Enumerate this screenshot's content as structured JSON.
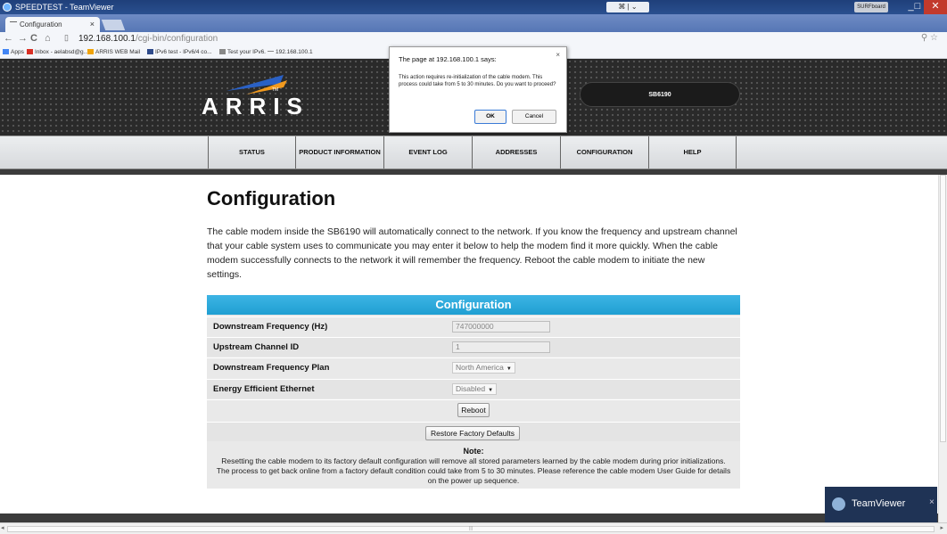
{
  "window": {
    "title": "SPEEDTEST - TeamViewer",
    "thumb_label": "⌘ | ⌄",
    "surfboard_label": "SURFboard"
  },
  "browser": {
    "tab_title": "Configuration",
    "url_host": "192.168.100.1",
    "url_path": "/cgi-bin/configuration",
    "bookmarks": [
      {
        "label": "Apps",
        "icon": "apps-grid-icon",
        "color": "#4285f4"
      },
      {
        "label": "Inbox - aelabsd@g...",
        "icon": "gmail-icon",
        "color": "#d93025"
      },
      {
        "label": "ARRIS WEB Mail",
        "icon": "mail-icon",
        "color": "#f0a30a"
      },
      {
        "label": "IPv6 test - IPv6/4 co...",
        "icon": "ipv6-icon",
        "color": "#2e4a8a"
      },
      {
        "label": "Test your IPv6.",
        "icon": "ipv6-test-icon",
        "color": "#888888"
      },
      {
        "label": "192.168.100.1",
        "icon": "link-icon",
        "color": "#888888"
      }
    ]
  },
  "header": {
    "brand": "ARRIS",
    "tm": "TM",
    "model": "SB6190"
  },
  "menu": [
    "STATUS",
    "PRODUCT INFORMATION",
    "EVENT LOG",
    "ADDRESSES",
    "CONFIGURATION",
    "HELP"
  ],
  "page": {
    "title": "Configuration",
    "intro": "The cable modem inside the SB6190 will automatically connect to the network. If you know the frequency and upstream channel that your cable system uses to communicate you may enter it below to help the modem find it more quickly. When the cable modem successfully connects to the network it will remember the frequency. Reboot the cable modem to initiate the new settings."
  },
  "config": {
    "header": "Configuration",
    "downstream_label": "Downstream Frequency (Hz)",
    "downstream_value": "747000000",
    "upstream_label": "Upstream Channel ID",
    "upstream_value": "1",
    "plan_label": "Downstream Frequency Plan",
    "plan_value": "North America",
    "eee_label": "Energy Efficient Ethernet",
    "eee_value": "Disabled",
    "reboot_label": "Reboot",
    "restore_label": "Restore Factory Defaults",
    "note_title": "Note:",
    "note_text": "Resetting the cable modem to its factory default configuration will remove all stored parameters learned by the cable modem during prior initializations. The process to get back online from a factory default condition could take from 5 to 30 minutes. Please reference the cable modem User Guide for details on the power up sequence."
  },
  "dialog": {
    "title": "The page at 192.168.100.1 says:",
    "message": "This action requires re-initialization of the cable modem. This process could take from 5 to 30 minutes. Do you want to proceed?",
    "ok": "OK",
    "cancel": "Cancel"
  },
  "teamviewer": {
    "name": "TeamViewer"
  },
  "colors": {
    "accent": "#1f9fd2",
    "header_bg": "#2a2a2a",
    "logo_blue": "#2a61c6",
    "logo_orange": "#f29a1e"
  }
}
